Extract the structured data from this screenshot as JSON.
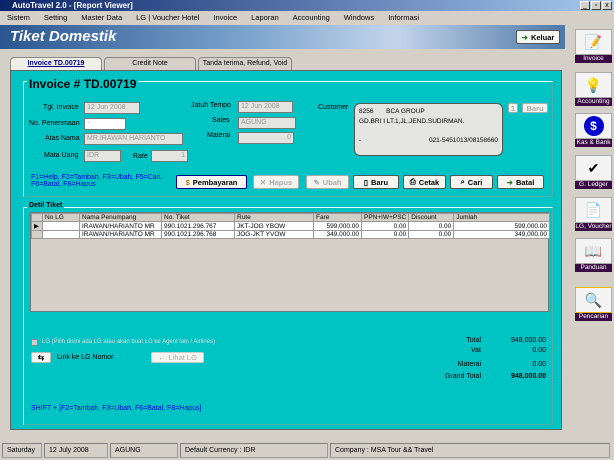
{
  "window": {
    "title": "AutoTravel 2.0 - [Report Viewer]",
    "controls": [
      "_",
      "▫",
      "x"
    ]
  },
  "menu": [
    "Sistem",
    "Setting",
    "Master Data",
    "LG | Voucher Hotel",
    "Invoice",
    "Laporan",
    "Accounting",
    "Windows",
    "Informasi"
  ],
  "header": {
    "title": "Tiket Domestik",
    "keluar": "Keluar"
  },
  "tabs": [
    "Invoice TD.00719",
    "Credit Note",
    "Tanda terima, Refund, Void"
  ],
  "invoice": {
    "heading": "Invoice # TD.00719",
    "tgl_label": "Tgl. Invoice",
    "tgl": "12 Jun 2008",
    "penerimaan_label": "No. Penerimaan",
    "penerimaan": "-",
    "atas_nama_label": "Atas Nama",
    "atas_nama": "MR.IRAWAN HARIANTO",
    "mata_uang_label": "Mata Uang",
    "mata_uang": "IDR",
    "rate_label": "Rate",
    "rate": "1",
    "jatuh_tempo_label": "Jatuh Tempo",
    "jatuh_tempo": "12 Jun 2008",
    "sales_label": "Sales",
    "sales": "AGUNG",
    "materai_label": "Materai",
    "materai": "0",
    "customer_label": "Customer",
    "customer": {
      "code": "8256",
      "name": "BCA GROUP",
      "address": "GD.BRI I LT.1,JL.JEND.SUDIRMAN.",
      "dash": "-",
      "phone": "021-5451013/08158660"
    },
    "cust_btn_1": "1",
    "cust_btn_baru": "Baru",
    "help": "F1=Help, F2=Tambah, F3=Ubah, F5=Cari, F6=Batal, F8=Hapus",
    "buttons": {
      "pembayaran": "Pembayaran",
      "hapus": "Hapus",
      "ubah": "Ubah",
      "baru": "Baru",
      "cetak": "Cetak",
      "cari": "Cari",
      "batal": "Batal"
    }
  },
  "detail": {
    "heading": "Detil Tiket",
    "columns": [
      "No LG",
      "Nama Penumpang",
      "No. Tiket",
      "Rute",
      "Fare",
      "PPN+IW+PSC",
      "Discount",
      "Jumlah"
    ],
    "rows": [
      [
        "",
        "IRAWAN/HARIANTO MR",
        "990.1021.296.767",
        "JKT-JOG YBOW",
        "599,000.00",
        "0.00",
        "0.00",
        "599,000.00"
      ],
      [
        "",
        "IRAWAN/HARIANTO MR",
        "990.1021.296.768",
        "JOG-JKT YVOW",
        "349,000.00",
        "0.00",
        "0.00",
        "349,000.00"
      ]
    ],
    "lg_checkbox": "LG (Pilih disini ada LG atau akan buat LG ke Agent lain / Airlines)",
    "link_lg": "Link ke LG Nomor",
    "lihat_lg": "Lihat LG",
    "totals": [
      [
        "Total",
        "948,000.00"
      ],
      [
        "Vat",
        "0.00"
      ],
      [
        "Materai",
        "0.00"
      ],
      [
        "Grand Total",
        "948,000.00"
      ]
    ],
    "shift_help": "SHIFT + [F2=Tambah, F3=Ubah, F6=Batal, F8=Hapus]"
  },
  "sidebar": [
    {
      "label": "Invoice",
      "icon": "invoice-icon",
      "glyph": "📝"
    },
    {
      "label": "Accounting",
      "icon": "accounting-icon",
      "glyph": "💡"
    },
    {
      "label": "Kas & Bank",
      "icon": "dollar-icon",
      "glyph": "$"
    },
    {
      "label": "G. Ledger",
      "icon": "ledger-icon",
      "glyph": "✔"
    },
    {
      "label": "LG, Voucher",
      "icon": "document-icon",
      "glyph": "📄"
    },
    {
      "label": "Panduan",
      "icon": "book-icon",
      "glyph": "📖"
    },
    {
      "label": "Pencarian",
      "icon": "search-icon",
      "glyph": "🔍"
    }
  ],
  "status": [
    "Saturday",
    "12 July 2008",
    "AGUNG",
    "Default Currency : IDR",
    "Company : MSA Tour && Travel"
  ],
  "colors": {
    "panel": "#00c4c4",
    "banner": "#2a5590",
    "help_text": "#0000cc",
    "sidebar_label": "#3a0a44"
  }
}
